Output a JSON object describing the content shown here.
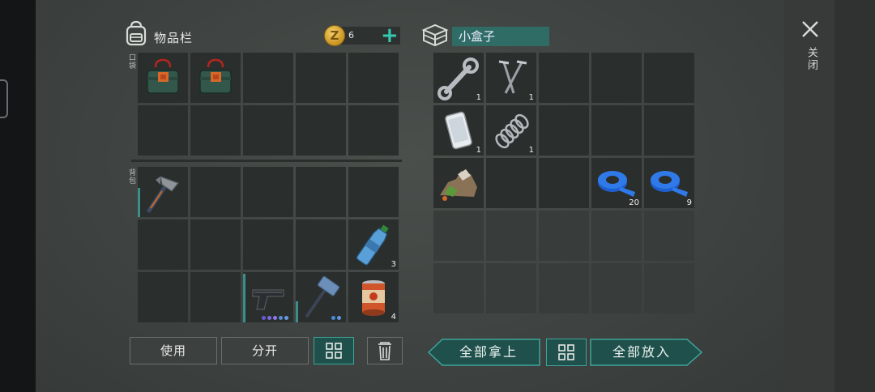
{
  "inventory": {
    "title": "物品栏",
    "coin_symbol": "Z",
    "coin_count": "6",
    "pocket_label": "口袋",
    "backpack_label": "背包",
    "pocket_items": [
      {
        "icon": "toolbox-icon",
        "count": ""
      },
      {
        "icon": "toolbox-icon",
        "count": ""
      }
    ],
    "backpack": {
      "hammer_count": "",
      "bottle_count": "3",
      "can_count": "4"
    }
  },
  "container": {
    "title": "小盒子",
    "items": [
      {
        "icon": "wrench-icon",
        "count": "1"
      },
      {
        "icon": "nails-icon",
        "count": "1"
      },
      {
        "icon": "smartphone-icon",
        "count": "1"
      },
      {
        "icon": "spring-icon",
        "count": "1"
      },
      {
        "icon": "scrap-pile-icon",
        "count": ""
      },
      {
        "icon": "blue-tape-icon",
        "count": "20"
      },
      {
        "icon": "blue-tape-icon",
        "count": "9"
      }
    ]
  },
  "buttons": {
    "use": "使用",
    "split": "分开",
    "take_all": "全部拿上",
    "put_all": "全部放入"
  },
  "close_label": "关闭",
  "colors": {
    "accent": "#35c9b2",
    "teal_button": "#1f504b",
    "slot": "#2a2e2d",
    "background": "#434745"
  }
}
